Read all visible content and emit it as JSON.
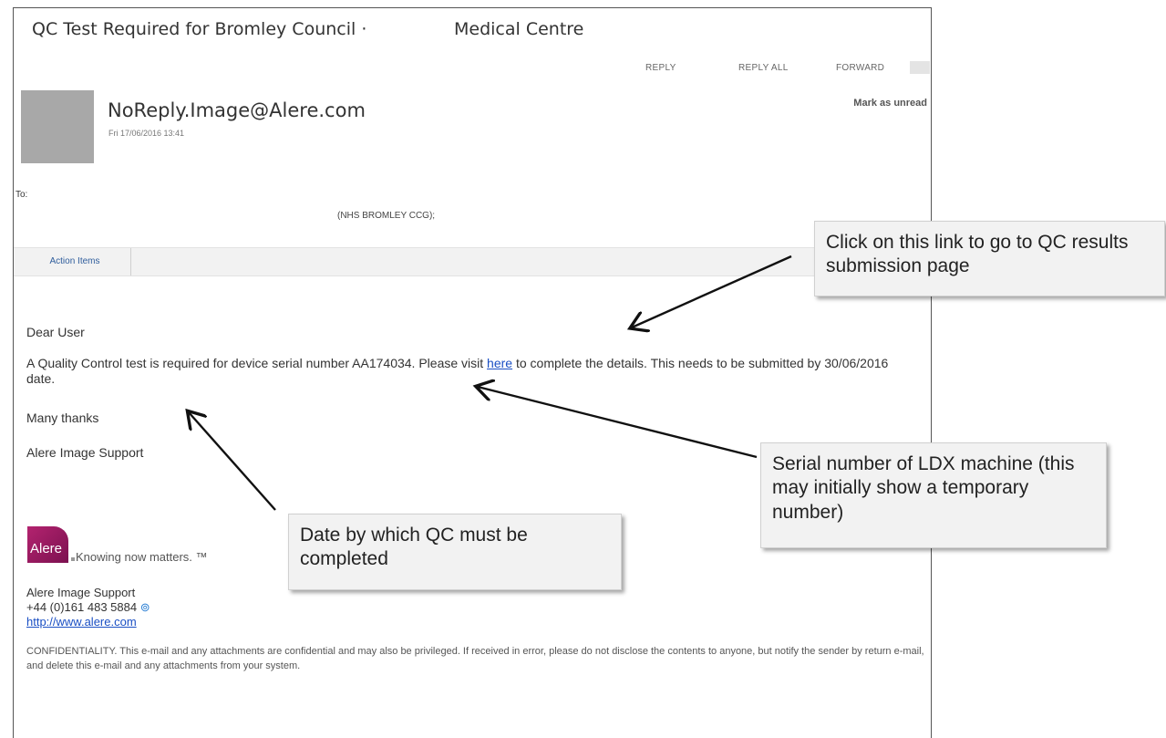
{
  "email": {
    "subject_part1": "QC Test Required for Bromley Council ·",
    "subject_part2": "Medical Centre",
    "actions": {
      "reply": "REPLY",
      "reply_all": "REPLY ALL",
      "forward": "FORWARD"
    },
    "sender": "NoReply.Image@Alere.com",
    "sent": "Fri 17/06/2016 13:41",
    "mark_unread": "Mark as unread",
    "to_label": "To:",
    "to_value": "(NHS BROMLEY CCG);",
    "tab_action_items": "Action Items",
    "greeting": "Dear User",
    "para1_before": "A Quality Control test is required for device serial number AA174034. Please visit ",
    "para1_link": "here",
    "para1_after": " to complete the details. This needs to be submitted by 30/06/2016 date.",
    "thanks": "Many thanks",
    "sign": "Alere Image Support",
    "logo_text": "Alere",
    "tagline": "Knowing now matters.",
    "tm": "™",
    "sig_name": "Alere Image Support",
    "sig_phone": "+44 (0)161 483 5884",
    "sig_url": "http://www.alere.com",
    "confidentiality": "CONFIDENTIALITY. This e-mail and any attachments are confidential and may also be privileged. If received in error, please do not disclose the contents to anyone, but notify the sender by return e-mail, and delete this e-mail and any attachments from your system."
  },
  "callouts": {
    "link": "Click on this link to go to QC results submission page",
    "serial": "Serial number of LDX machine (this may initially show a temporary number)",
    "date": "Date by which QC must be completed"
  }
}
